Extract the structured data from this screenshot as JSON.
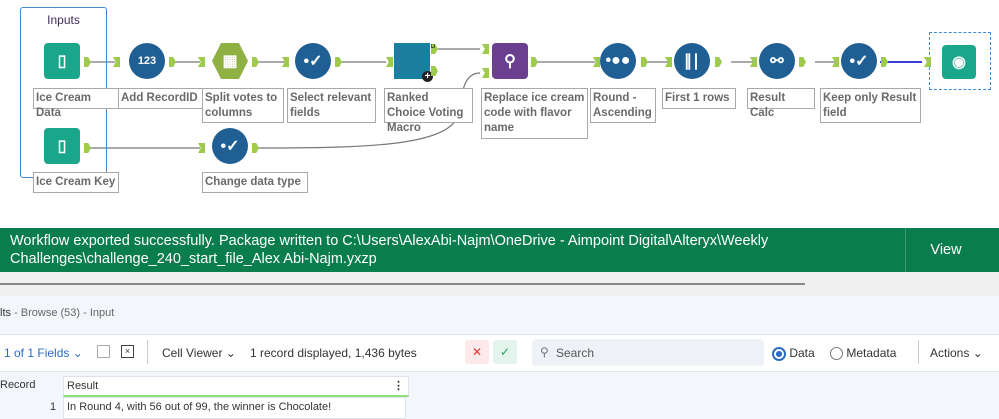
{
  "container": {
    "title": "Inputs"
  },
  "tools": [
    {
      "label": "Ice Cream Data",
      "icon": "input-book-icon"
    },
    {
      "label": "Add RecordID",
      "icon": "record-id-icon"
    },
    {
      "label": "Split votes to columns",
      "icon": "text-to-columns-icon"
    },
    {
      "label": "Select relevant fields",
      "icon": "select-icon"
    },
    {
      "label": "Ranked Choice Voting Macro",
      "icon": "macro-icon"
    },
    {
      "label": "Replace ice cream code with flavor name",
      "icon": "find-replace-icon"
    },
    {
      "label": "Round - Ascending",
      "icon": "sort-icon"
    },
    {
      "label": "First 1 rows",
      "icon": "sample-icon"
    },
    {
      "label": "Result Calc",
      "icon": "formula-icon"
    },
    {
      "label": "Keep only Result field",
      "icon": "select-icon"
    },
    {
      "label": "",
      "icon": "browse-icon"
    },
    {
      "label": "Ice Cream Key",
      "icon": "input-book-icon"
    },
    {
      "label": "Change data type",
      "icon": "select-icon"
    }
  ],
  "anchors": {
    "d": "D",
    "i": "I",
    "v": "V",
    "f": "F",
    "r": "R"
  },
  "banner": {
    "message": "Workflow exported successfully. Package written to C:\\Users\\AlexAbi-Najm\\OneDrive - Aimpoint Digital\\Alteryx\\Weekly Challenges\\challenge_240_start_file_Alex Abi-Najm.yxzp",
    "view": "View"
  },
  "results": {
    "title": "lts",
    "subtitle": " - Browse (53) - Input",
    "fields": "1 of 1 Fields",
    "viewer": "Cell Viewer",
    "summary": "1 record displayed, 1,436 bytes",
    "search_placeholder": "Search",
    "radio_data": "Data",
    "radio_metadata": "Metadata",
    "actions": "Actions",
    "columns": [
      "Record",
      "Result"
    ],
    "rows": [
      {
        "record": "1",
        "result": "In Round 4, with 56 out of 99, the winner is Chocolate!"
      }
    ]
  },
  "colors": {
    "banner": "#0a7d4c",
    "tool_blue": "#1f5f94",
    "input_green": "#1aa68a",
    "macro": "#1a7fa0",
    "purple": "#6a3f8f",
    "anchor": "#9ecb4e"
  }
}
